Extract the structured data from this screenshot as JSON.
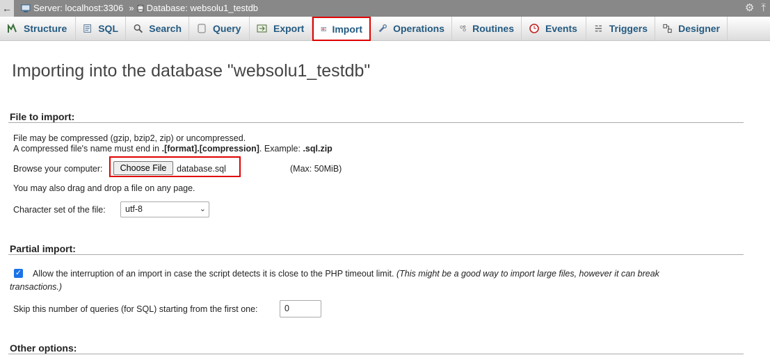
{
  "breadcrumb": {
    "server": "Server: localhost:3306",
    "separator": "»",
    "database": "Database: websolu1_testdb"
  },
  "tabs": [
    {
      "label": "Structure",
      "icon": "structure-icon"
    },
    {
      "label": "SQL",
      "icon": "sql-icon"
    },
    {
      "label": "Search",
      "icon": "search-icon"
    },
    {
      "label": "Query",
      "icon": "query-icon"
    },
    {
      "label": "Export",
      "icon": "export-icon"
    },
    {
      "label": "Import",
      "icon": "import-icon",
      "active": true
    },
    {
      "label": "Operations",
      "icon": "wrench-icon"
    },
    {
      "label": "Routines",
      "icon": "routines-icon"
    },
    {
      "label": "Events",
      "icon": "clock-icon"
    },
    {
      "label": "Triggers",
      "icon": "triggers-icon"
    },
    {
      "label": "Designer",
      "icon": "designer-icon"
    }
  ],
  "title": "Importing into the database \"websolu1_testdb\"",
  "file_import": {
    "legend": "File to import:",
    "line1": "File may be compressed (gzip, bzip2, zip) or uncompressed.",
    "line2_prefix": "A compressed file's name must end in ",
    "line2_bold": ".[format].[compression]",
    "line2_mid": ". Example: ",
    "line2_example": ".sql.zip",
    "browse_label": "Browse your computer:",
    "choose_button": "Choose File",
    "file_name": "database.sql",
    "max_size": "(Max: 50MiB)",
    "drag_hint": "You may also drag and drop a file on any page.",
    "charset_label": "Character set of the file:",
    "charset_value": "utf-8"
  },
  "partial_import": {
    "legend": "Partial import:",
    "interrupt_label": "Allow the interruption of an import in case the script detects it is close to the PHP timeout limit.",
    "interrupt_note_1": "(This might be a good way to import large files, however it can break",
    "interrupt_note_2": "transactions.)",
    "interrupt_checked": true,
    "skip_label": "Skip this number of queries (for SQL) starting from the first one:",
    "skip_value": "0"
  },
  "other_options": {
    "legend": "Other options:"
  },
  "colors": {
    "tab_text": "#235a81",
    "highlight": "#e00000",
    "topbar": "#888888"
  }
}
